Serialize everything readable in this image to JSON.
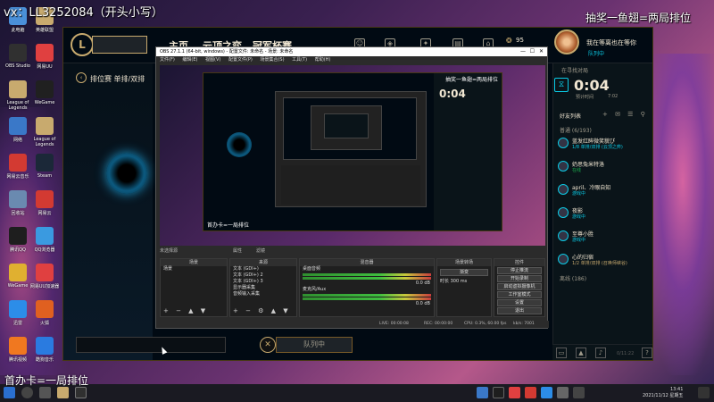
{
  "overlay": {
    "top_left": "vx：LL3252084（开头小写）",
    "top_right": "抽奖一鱼翅=两局排位",
    "bottom_left": "首办卡=一局排位"
  },
  "desktop_icons": [
    {
      "label": "此电脑",
      "color": "#4a90d9"
    },
    {
      "label": "OBS Studio",
      "color": "#303030"
    },
    {
      "label": "League of Legends",
      "color": "#c8aa6e"
    },
    {
      "label": "网络",
      "color": "#3a78c8"
    },
    {
      "label": "网易云音乐",
      "color": "#d33a32"
    },
    {
      "label": "回收站",
      "color": "#6a8ab0"
    },
    {
      "label": "腾讯QQ",
      "color": "#1e1e1e"
    },
    {
      "label": "WeGame",
      "color": "#e0b030"
    },
    {
      "label": "迅雷",
      "color": "#2c8de8"
    },
    {
      "label": "腾讯视频",
      "color": "#f07820"
    },
    {
      "label": "英雄联盟",
      "color": "#c8aa6e"
    },
    {
      "label": "网易UU",
      "color": "#e04040"
    },
    {
      "label": "WeGame",
      "color": "#202020"
    },
    {
      "label": "League of Legends",
      "color": "#c8aa6e"
    },
    {
      "label": "Steam",
      "color": "#1b2838"
    },
    {
      "label": "网易云",
      "color": "#d33a32"
    },
    {
      "label": "QQ浏览器",
      "color": "#3a9ae0"
    },
    {
      "label": "网易UU加速器",
      "color": "#e04040"
    },
    {
      "label": "火狐",
      "color": "#e06020"
    },
    {
      "label": "酷狗音乐",
      "color": "#2a7be0"
    }
  ],
  "client": {
    "logo": "L",
    "play_label": "",
    "nav_tabs": [
      "主页",
      "云顶之弈",
      "冠军杯赛"
    ],
    "rp": "95",
    "player_name": "我在等离也在等你",
    "player_status": "队列中",
    "queue_title": "排位赛 单排/双排",
    "back_icon": "‹",
    "queue_button": "队列中",
    "cancel_icon": "✕"
  },
  "friends": {
    "timer_label": "在寻找对局",
    "timer": "0:04",
    "timer_estimated_label": "预计时间",
    "timer_estimated": "7:02",
    "header": "好友列表",
    "group_label": "普通 (6/193)",
    "list": [
      {
        "name": "蓝发红眸微笑貌ぴ",
        "status": "1/8 单排/双排 (云顶之弈)",
        "kind": "ig"
      },
      {
        "name": "奶思兔米特洛",
        "status": "在线",
        "kind": "online"
      },
      {
        "name": "april、冷眼自知",
        "status": "游戏中",
        "kind": "ig"
      },
      {
        "name": "夜影",
        "status": "游戏中",
        "kind": "ig"
      },
      {
        "name": "至尊小胜",
        "status": "游戏中",
        "kind": "ig"
      },
      {
        "name": "心的归宿",
        "status": "1/2 单排/双排 (召唤师峡谷)",
        "kind": "away"
      }
    ],
    "group2_label": "离线 (186)",
    "version": "0/11:22"
  },
  "obs": {
    "title": "OBS 27.1.1 (64-bit, windows) - 配置文件: 未命名 - 场景: 未命名",
    "menu": [
      "文件(F)",
      "编辑(E)",
      "视图(V)",
      "配置文件(P)",
      "场景集合(S)",
      "工具(T)",
      "帮助(H)"
    ],
    "preview_inner_title": "抽奖一鱼翅=两局排位",
    "preview_inner_sub": "首办卡=一局排位",
    "inner_timer": "0:04",
    "docks": {
      "scenes": {
        "title": "场景",
        "items": [
          "场景"
        ]
      },
      "sources": {
        "title": "来源",
        "items": [
          "文本 (GDI+)",
          "文本 (GDI+) 2",
          "文本 (GDI+) 3",
          "显示器采集",
          "音频输入采集"
        ]
      },
      "mixer": {
        "title": "混音器",
        "items": [
          {
            "name": "桌面音频",
            "db": "0.0 dB"
          },
          {
            "name": "麦克风/Aux",
            "db": "0.0 dB"
          }
        ]
      },
      "transitions": {
        "title": "场景转场",
        "value": "渐变",
        "duration_label": "时长",
        "duration": "300 ms"
      },
      "controls": {
        "title": "控件",
        "buttons": [
          "停止推流",
          "开始录制",
          "启动虚拟摄像机",
          "工作室模式",
          "设置",
          "退出"
        ]
      }
    },
    "status": {
      "live": "LIVE: 00:00:08",
      "rec": "REC: 00:00:00",
      "cpu": "CPU: 0.3%, 60.00 fps",
      "kbps": "kb/s: 7001"
    },
    "no_source_label": "未选择源",
    "properties_label": "属性",
    "filters_label": "滤镜"
  },
  "taskbar": {
    "time": "13:41",
    "date": "2021/11/12 星期五"
  }
}
